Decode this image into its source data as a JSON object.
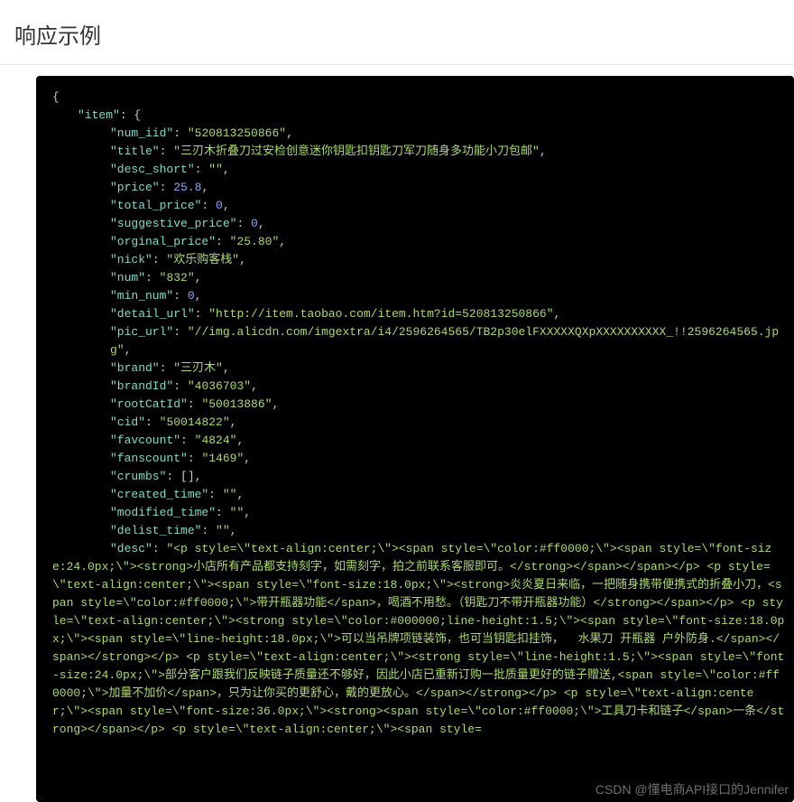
{
  "section_title": "响应示例",
  "item": {
    "num_iid": "520813250866",
    "title": "三刃木折叠刀过安检创意迷你钥匙扣钥匙刀军刀随身多功能小刀包邮",
    "desc_short": "",
    "price": 25.8,
    "total_price": 0,
    "suggestive_price": 0,
    "orginal_price": "25.80",
    "nick": "欢乐购客栈",
    "num": "832",
    "min_num": 0,
    "detail_url": "http://item.taobao.com/item.htm?id=520813250866",
    "pic_url": "//img.alicdn.com/imgextra/i4/2596264565/TB2p30elFXXXXXQXpXXXXXXXXXX_!!2596264565.jpg",
    "brand": "三刃木",
    "brandId": "4036703",
    "rootCatId": "50013886",
    "cid": "50014822",
    "favcount": "4824",
    "fanscount": "1469",
    "crumbs": "[]",
    "created_time": "",
    "modified_time": "",
    "delist_time": "",
    "desc": "<p style=\\\"text-align:center;\\\"><span style=\\\"color:#ff0000;\\\"><span style=\\\"font-size:24.0px;\\\"><strong>小店所有产品都支持刻字，如需刻字，拍之前联系客服即可。</strong></span></span></p> <p style=\\\"text-align:center;\\\"><span style=\\\"font-size:18.0px;\\\"><strong>炎炎夏日来临，一把随身携带便携式的折叠小刀，<span style=\\\"color:#ff0000;\\\">带开瓶器功能</span>，喝酒不用愁。（钥匙刀不带开瓶器功能）</strong></span></p> <p style=\\\"text-align:center;\\\"><strong style=\\\"color:#000000;line-height:1.5;\\\"><span style=\\\"font-size:18.0px;\\\"><span style=\\\"line-height:18.0px;\\\">可以当吊牌项链装饰，也可当钥匙扣挂饰，  水果刀 开瓶器 户外防身.</span></span></strong></p> <p style=\\\"text-align:center;\\\"><strong style=\\\"line-height:1.5;\\\"><span style=\\\"font-size:24.0px;\\\">部分客户跟我们反映链子质量还不够好，因此小店已重新订购一批质量更好的链子赠送,<span style=\\\"color:#ff0000;\\\">加量不加价</span>，只为让你买的更舒心，戴的更放心。</span></strong></p> <p style=\\\"text-align:center;\\\"><span style=\\\"font-size:36.0px;\\\"><strong><span style=\\\"color:#ff0000;\\\">工具刀卡和链子</span>一条</strong></span></p> <p style=\\\"text-align:center;\\\"><span style="
  },
  "watermark": "CSDN @懂电商API接口的Jennifer"
}
